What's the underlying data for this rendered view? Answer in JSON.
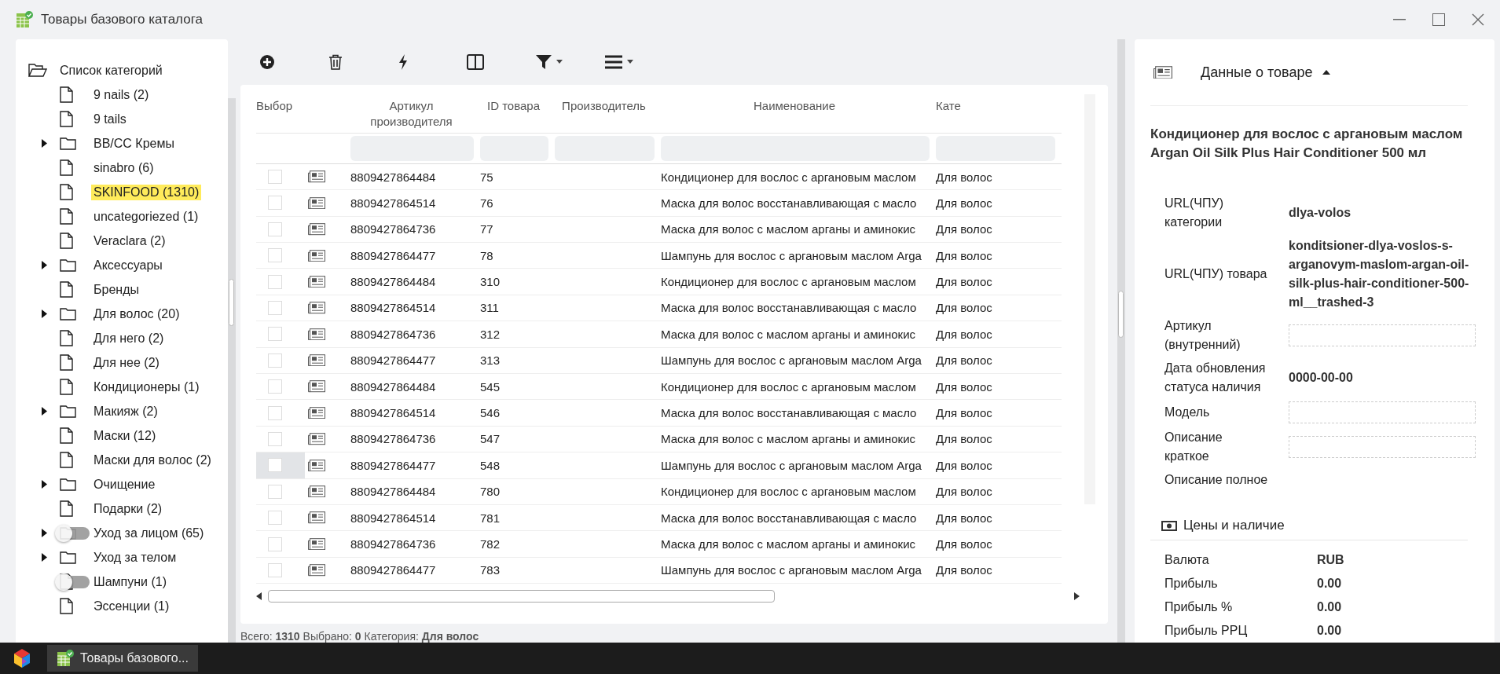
{
  "window": {
    "title": "Товары базового каталога"
  },
  "sidebar": {
    "root": {
      "label": "Список категорий",
      "expanded": true,
      "children": [
        {
          "kind": "leaf",
          "label": "9 nails (2)",
          "selected": false
        },
        {
          "kind": "leaf",
          "label": "9 tails",
          "selected": false
        },
        {
          "kind": "folder",
          "label": "BB/CC Кремы",
          "selected": false,
          "expanded": false
        },
        {
          "kind": "leaf",
          "label": "sinabro (6)",
          "selected": false
        },
        {
          "kind": "leaf",
          "label": "SKINFOOD (1310)",
          "selected": true
        },
        {
          "kind": "leaf",
          "label": "uncategoriezed (1)",
          "selected": false
        },
        {
          "kind": "leaf",
          "label": "Veraclara (2)",
          "selected": false
        },
        {
          "kind": "folder",
          "label": "Аксессуары",
          "selected": false,
          "expanded": false
        },
        {
          "kind": "leaf",
          "label": "Бренды",
          "selected": false
        },
        {
          "kind": "folder",
          "label": "Для волос (20)",
          "selected": false,
          "expanded": false
        },
        {
          "kind": "leaf",
          "label": "Для него (2)",
          "selected": false
        },
        {
          "kind": "leaf",
          "label": "Для нее (2)",
          "selected": false
        },
        {
          "kind": "leaf",
          "label": "Кондиционеры (1)",
          "selected": false
        },
        {
          "kind": "folder",
          "label": "Макияж (2)",
          "selected": false,
          "expanded": false
        },
        {
          "kind": "leaf",
          "label": "Маски (12)",
          "selected": false
        },
        {
          "kind": "leaf",
          "label": "Маски для волос (2)",
          "selected": false
        },
        {
          "kind": "folder",
          "label": "Очищение",
          "selected": false,
          "expanded": false
        },
        {
          "kind": "leaf",
          "label": "Подарки (2)",
          "selected": false
        },
        {
          "kind": "folder",
          "label": "Уход за лицом (65)",
          "selected": false,
          "expanded": false,
          "toggle": {
            "on": false
          }
        },
        {
          "kind": "folder",
          "label": "Уход за телом",
          "selected": false,
          "expanded": false
        },
        {
          "kind": "leaf",
          "label": "Шампуни (1)",
          "selected": false,
          "toggle": {
            "on": false
          }
        },
        {
          "kind": "leaf",
          "label": "Эссенции (1)",
          "selected": false
        }
      ]
    }
  },
  "table": {
    "columns": [
      "Выбор",
      "",
      "Артикул производителя",
      "ID товара",
      "Производитель",
      "Наименование",
      "Кате"
    ],
    "rows": [
      {
        "checked": false,
        "focused": false,
        "article": "8809427864484",
        "id": "75",
        "name": "Кондиционер для вослос с аргановым маслом",
        "category": "Для волос"
      },
      {
        "checked": false,
        "focused": false,
        "article": "8809427864514",
        "id": "76",
        "name": "Маска для волос восстанавливающая с масло",
        "category": "Для волос"
      },
      {
        "checked": false,
        "focused": false,
        "article": "8809427864736",
        "id": "77",
        "name": "Маска для волос с маслом арганы и аминокис",
        "category": "Для волос"
      },
      {
        "checked": false,
        "focused": false,
        "article": "8809427864477",
        "id": "78",
        "name": "Шампунь для вослос с аргановым маслом Arga",
        "category": "Для волос"
      },
      {
        "checked": false,
        "focused": false,
        "article": "8809427864484",
        "id": "310",
        "name": "Кондиционер для вослос с аргановым маслом",
        "category": "Для волос"
      },
      {
        "checked": false,
        "focused": false,
        "article": "8809427864514",
        "id": "311",
        "name": "Маска для волос восстанавливающая с масло",
        "category": "Для волос"
      },
      {
        "checked": false,
        "focused": false,
        "article": "8809427864736",
        "id": "312",
        "name": "Маска для волос с маслом арганы и аминокис",
        "category": "Для волос"
      },
      {
        "checked": false,
        "focused": false,
        "article": "8809427864477",
        "id": "313",
        "name": "Шампунь для вослос с аргановым маслом Arga",
        "category": "Для волос"
      },
      {
        "checked": false,
        "focused": false,
        "article": "8809427864484",
        "id": "545",
        "name": "Кондиционер для вослос с аргановым маслом",
        "category": "Для волос"
      },
      {
        "checked": false,
        "focused": false,
        "article": "8809427864514",
        "id": "546",
        "name": "Маска для волос восстанавливающая с масло",
        "category": "Для волос"
      },
      {
        "checked": false,
        "focused": false,
        "article": "8809427864736",
        "id": "547",
        "name": "Маска для волос с маслом арганы и аминокис",
        "category": "Для волос"
      },
      {
        "checked": false,
        "focused": true,
        "article": "8809427864477",
        "id": "548",
        "name": "Шампунь для вослос с аргановым маслом Arga",
        "category": "Для волос"
      },
      {
        "checked": false,
        "focused": false,
        "article": "8809427864484",
        "id": "780",
        "name": "Кондиционер для вослос с аргановым маслом",
        "category": "Для волос"
      },
      {
        "checked": false,
        "focused": false,
        "article": "8809427864514",
        "id": "781",
        "name": "Маска для волос восстанавливающая с масло",
        "category": "Для волос"
      },
      {
        "checked": false,
        "focused": false,
        "article": "8809427864736",
        "id": "782",
        "name": "Маска для волос с маслом арганы и аминокис",
        "category": "Для волос"
      },
      {
        "checked": false,
        "focused": false,
        "article": "8809427864477",
        "id": "783",
        "name": "Шампунь для вослос с аргановым маслом Arga",
        "category": "Для волос"
      }
    ]
  },
  "status_bar": "Всего: **1310**  Выбрано: **0**  Категория: **Для волос**",
  "details": {
    "header": "Данные о товаре",
    "expanded": true,
    "title": "Кондиционер для вослос с аргановым маслом Argan Oil Silk Plus Hair Conditioner 500 мл",
    "properties": [
      {
        "kind": "text",
        "label": "URL(ЧПУ) категории",
        "value": "dlya-volos"
      },
      {
        "kind": "text",
        "label": "URL(ЧПУ) товара",
        "value": "konditsioner-dlya-voslos-s-arganovym-maslom-argan-oil-silk-plus-hair-conditioner-500-ml__trashed-3"
      },
      {
        "kind": "field",
        "label": "Артикул (внутренний)"
      },
      {
        "kind": "text",
        "label": "Дата обновления статуса наличия",
        "value": "0000-00-00"
      },
      {
        "kind": "field",
        "label": "Модель"
      },
      {
        "kind": "field",
        "label": "Описание краткое"
      },
      {
        "kind": "none",
        "label": "Описание полное"
      }
    ],
    "prices_header": "Цены и наличие",
    "prices": [
      {
        "label": "Валюта",
        "value": "RUB"
      },
      {
        "label": "Прибыль",
        "value": "0.00"
      },
      {
        "label": "Прибыль %",
        "value": "0.00"
      },
      {
        "label": "Прибыль РРЦ",
        "value": "0.00"
      }
    ]
  },
  "taskbar": {
    "items": [
      {
        "label": "Товары базового...",
        "selected": true
      }
    ]
  }
}
